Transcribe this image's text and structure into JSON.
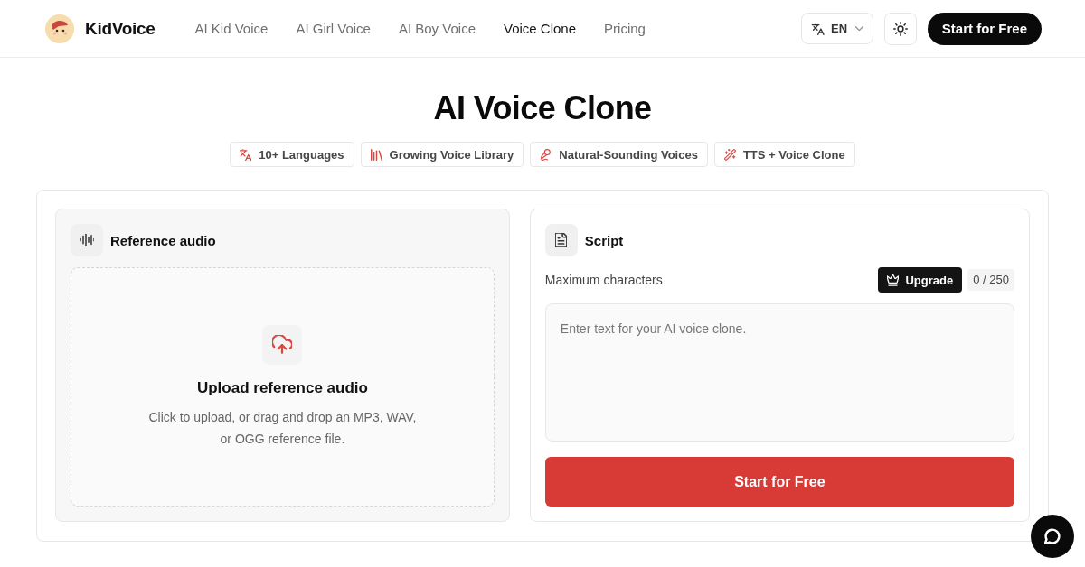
{
  "header": {
    "brand": "KidVoice",
    "nav": [
      {
        "label": "AI Kid Voice",
        "selected": false
      },
      {
        "label": "AI Girl Voice",
        "selected": false
      },
      {
        "label": "AI Boy Voice",
        "selected": false
      },
      {
        "label": "Voice Clone",
        "selected": true
      },
      {
        "label": "Pricing",
        "selected": false
      }
    ],
    "language": "EN",
    "cta": "Start for Free"
  },
  "hero": {
    "title": "AI Voice Clone",
    "features": [
      {
        "kind": "languages",
        "label": "10+ Languages"
      },
      {
        "kind": "library",
        "label": "Growing Voice Library"
      },
      {
        "kind": "natural",
        "label": "Natural-Sounding Voices"
      },
      {
        "kind": "clone",
        "label": "TTS + Voice Clone"
      }
    ]
  },
  "reference_audio": {
    "title": "Reference audio",
    "upload_title": "Upload reference audio",
    "upload_description": "Click to upload, or drag and drop an MP3, WAV, or OGG reference file."
  },
  "script": {
    "title": "Script",
    "limit_label": "Maximum characters",
    "upgrade": "Upgrade",
    "counter": "0 / 250",
    "placeholder": "Enter text for your AI voice clone.",
    "submit": "Start for Free"
  }
}
